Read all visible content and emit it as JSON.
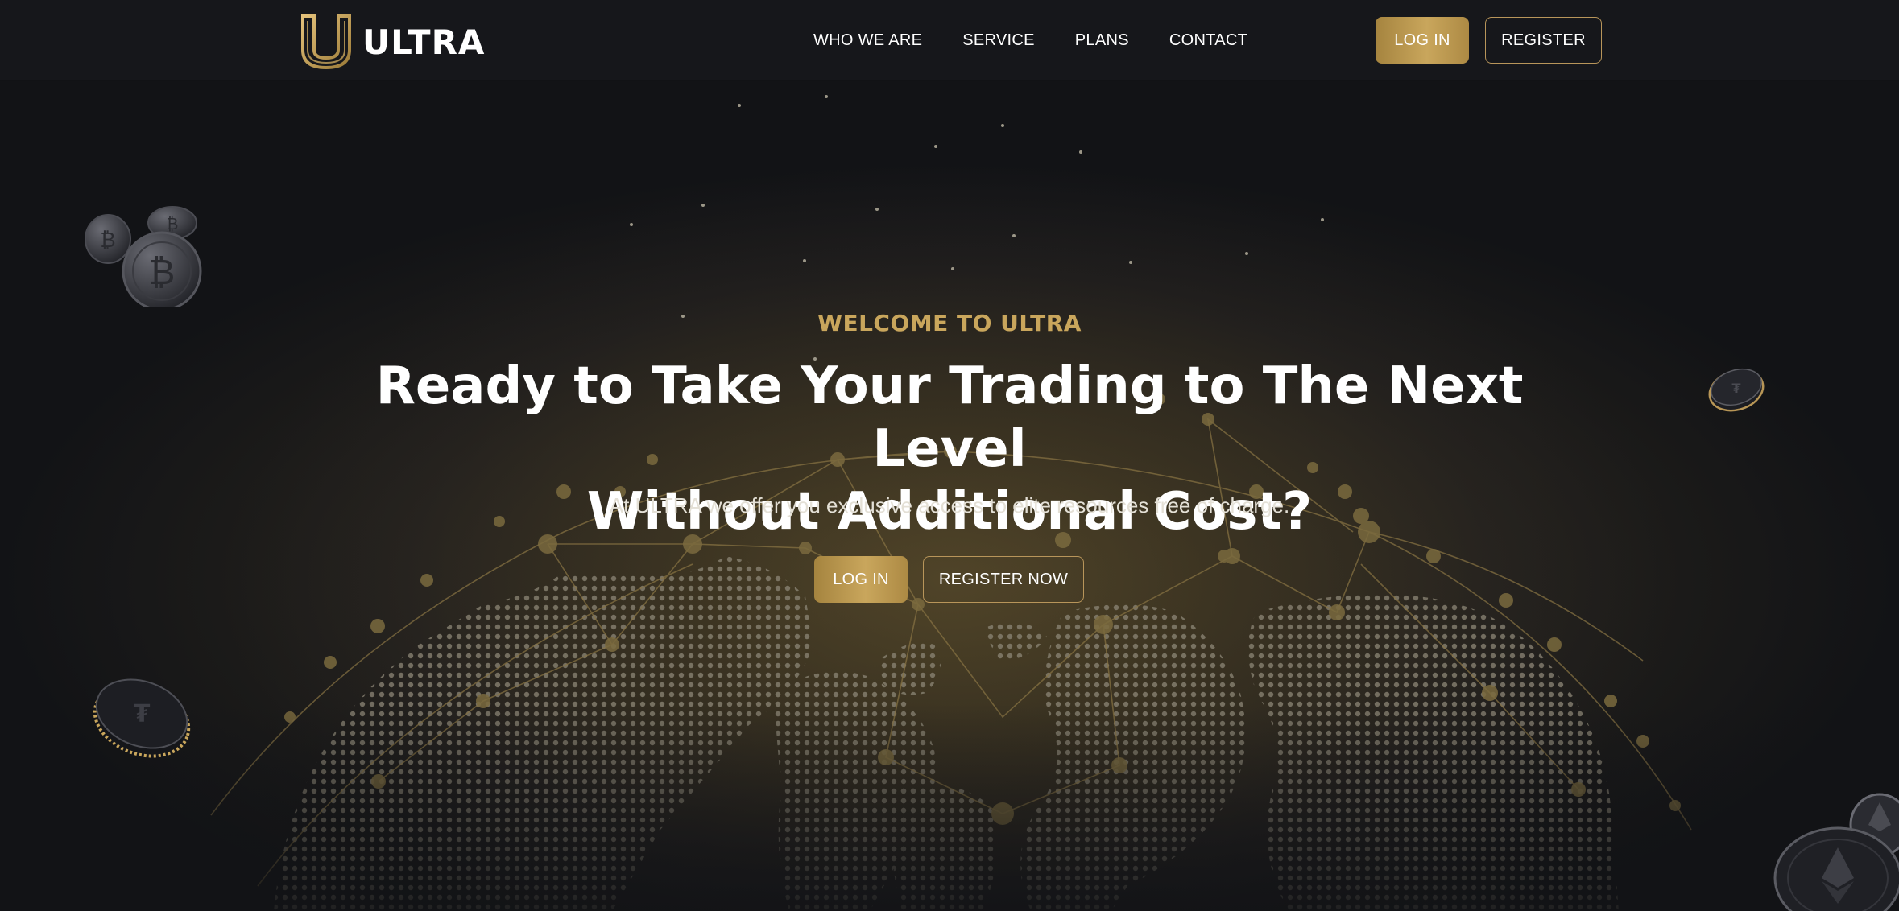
{
  "brand": {
    "name": "ULTRA",
    "accent": "#c9a65c",
    "accent_dark": "#a5843f"
  },
  "nav": {
    "links": [
      "WHO WE ARE",
      "SERVICE",
      "PLANS",
      "CONTACT"
    ],
    "login_label": "LOG IN",
    "register_label": "REGISTER"
  },
  "hero": {
    "eyebrow": "WELCOME TO ULTRA",
    "headline_line1": "Ready to Take Your Trading to The Next Level",
    "headline_line2": "Without Additional Cost?",
    "subheadline": "At ULTRA we offer you exclusive access to elite resources free of charge.",
    "login_label": "LOG IN",
    "register_label": "REGISTER NOW"
  },
  "decor": {
    "background_art": "dotted-globe-network",
    "coin_icons": [
      "bitcoin-coin-icon",
      "tether-coin-icon",
      "ethereum-coin-icon"
    ]
  }
}
